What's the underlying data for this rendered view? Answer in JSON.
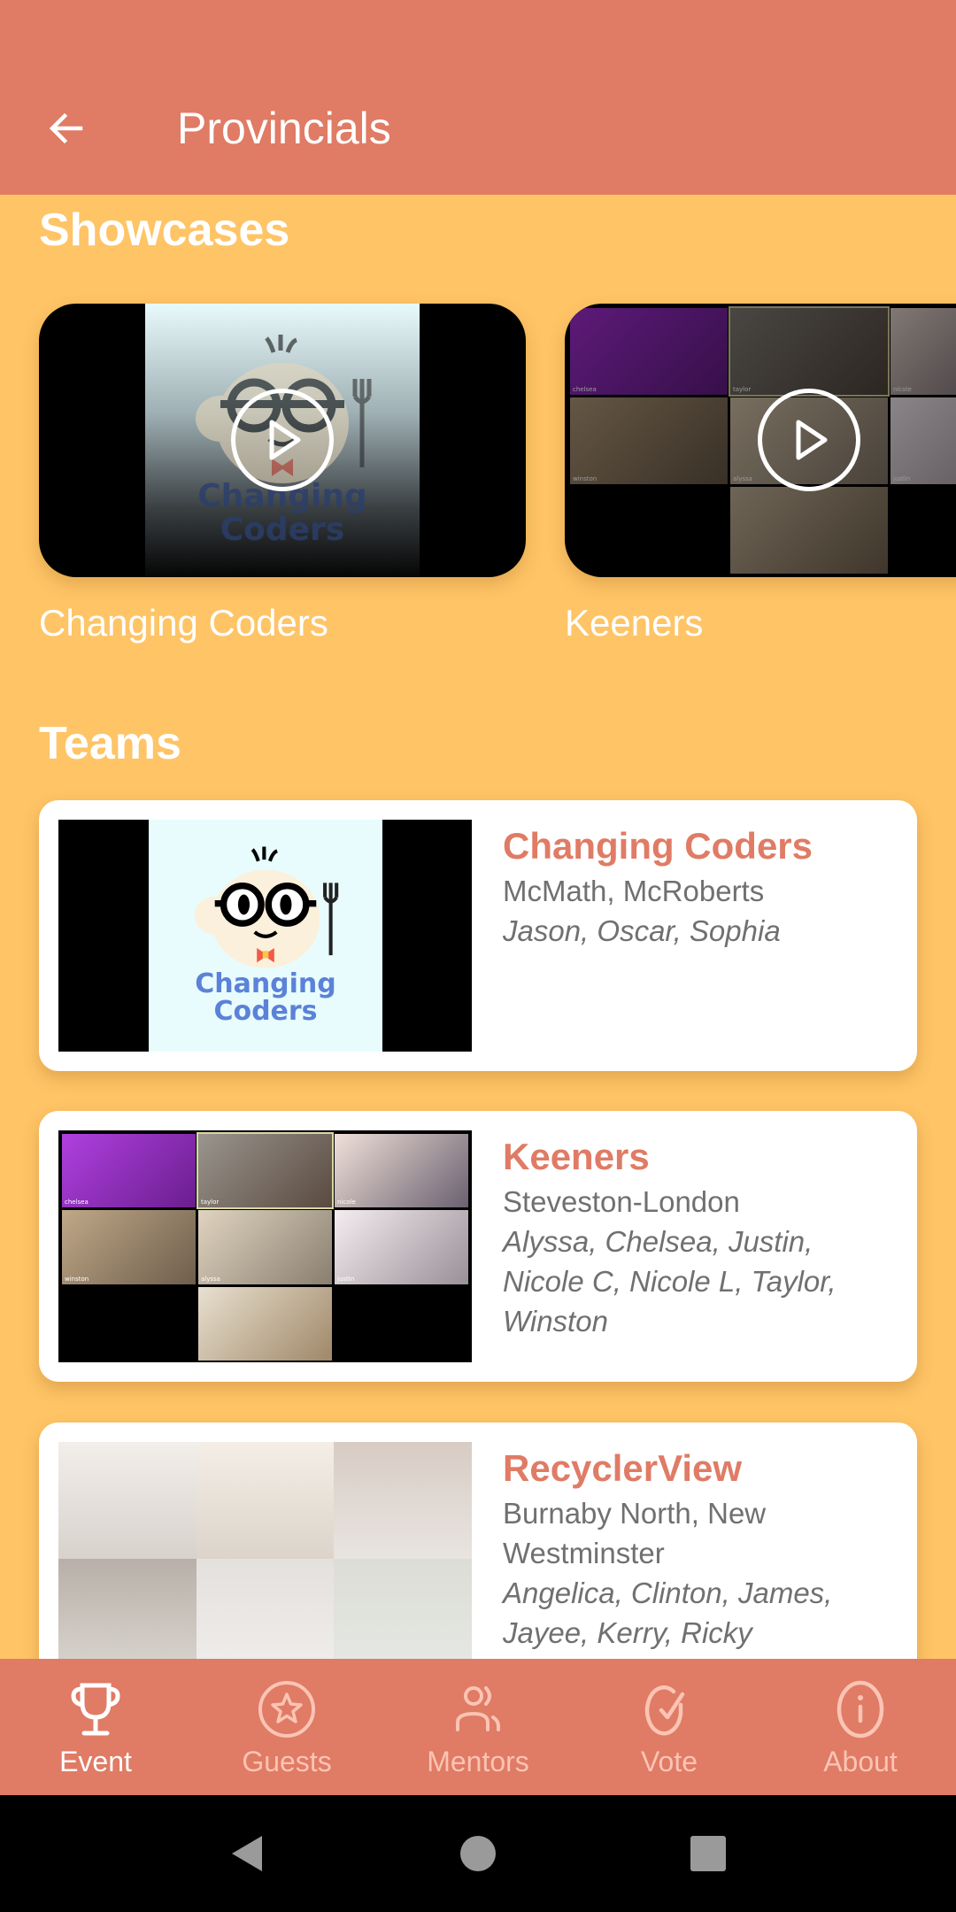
{
  "appbar": {
    "title": "Provincials",
    "back_icon": "arrow-left-icon"
  },
  "colors": {
    "primary": "#E07B65",
    "background": "#FEC466",
    "card": "#FFFFFF",
    "text_muted": "#707070",
    "nav_inactive": "#FBC4B4"
  },
  "showcases": {
    "title": "Showcases",
    "items": [
      {
        "caption": "Changing Coders",
        "thumbnail": "changing-coders-logo",
        "play_icon": "play-circle-icon"
      },
      {
        "caption": "Keeners",
        "thumbnail": "keeners-video-call",
        "play_icon": "play-circle-icon"
      }
    ]
  },
  "logo": {
    "line1": "Changing",
    "line2": "Coders"
  },
  "teams": {
    "title": "Teams",
    "items": [
      {
        "name": "Changing Coders",
        "school": "McMath, McRoberts",
        "members": "Jason, Oscar, Sophia"
      },
      {
        "name": "Keeners",
        "school": "Steveston-London",
        "members": "Alyssa, Chelsea, Justin, Nicole C, Nicole L, Taylor, Winston"
      },
      {
        "name": "RecyclerView",
        "school": "Burnaby North, New Westminster",
        "members": "Angelica, Clinton, James, Jayee, Kerry, Ricky"
      }
    ]
  },
  "zoom_tags": [
    "chelsea",
    "taylor",
    "nicole",
    "winston",
    "alyssa",
    "justin"
  ],
  "bottom_nav": {
    "items": [
      {
        "label": "Event",
        "icon": "trophy-icon",
        "active": true
      },
      {
        "label": "Guests",
        "icon": "star-circle-icon",
        "active": false
      },
      {
        "label": "Mentors",
        "icon": "people-icon",
        "active": false
      },
      {
        "label": "Vote",
        "icon": "check-circle-icon",
        "active": false
      },
      {
        "label": "About",
        "icon": "info-circle-icon",
        "active": false
      }
    ]
  },
  "system_nav": {
    "back": "back-triangle-icon",
    "home": "home-circle-icon",
    "recents": "recents-square-icon"
  }
}
